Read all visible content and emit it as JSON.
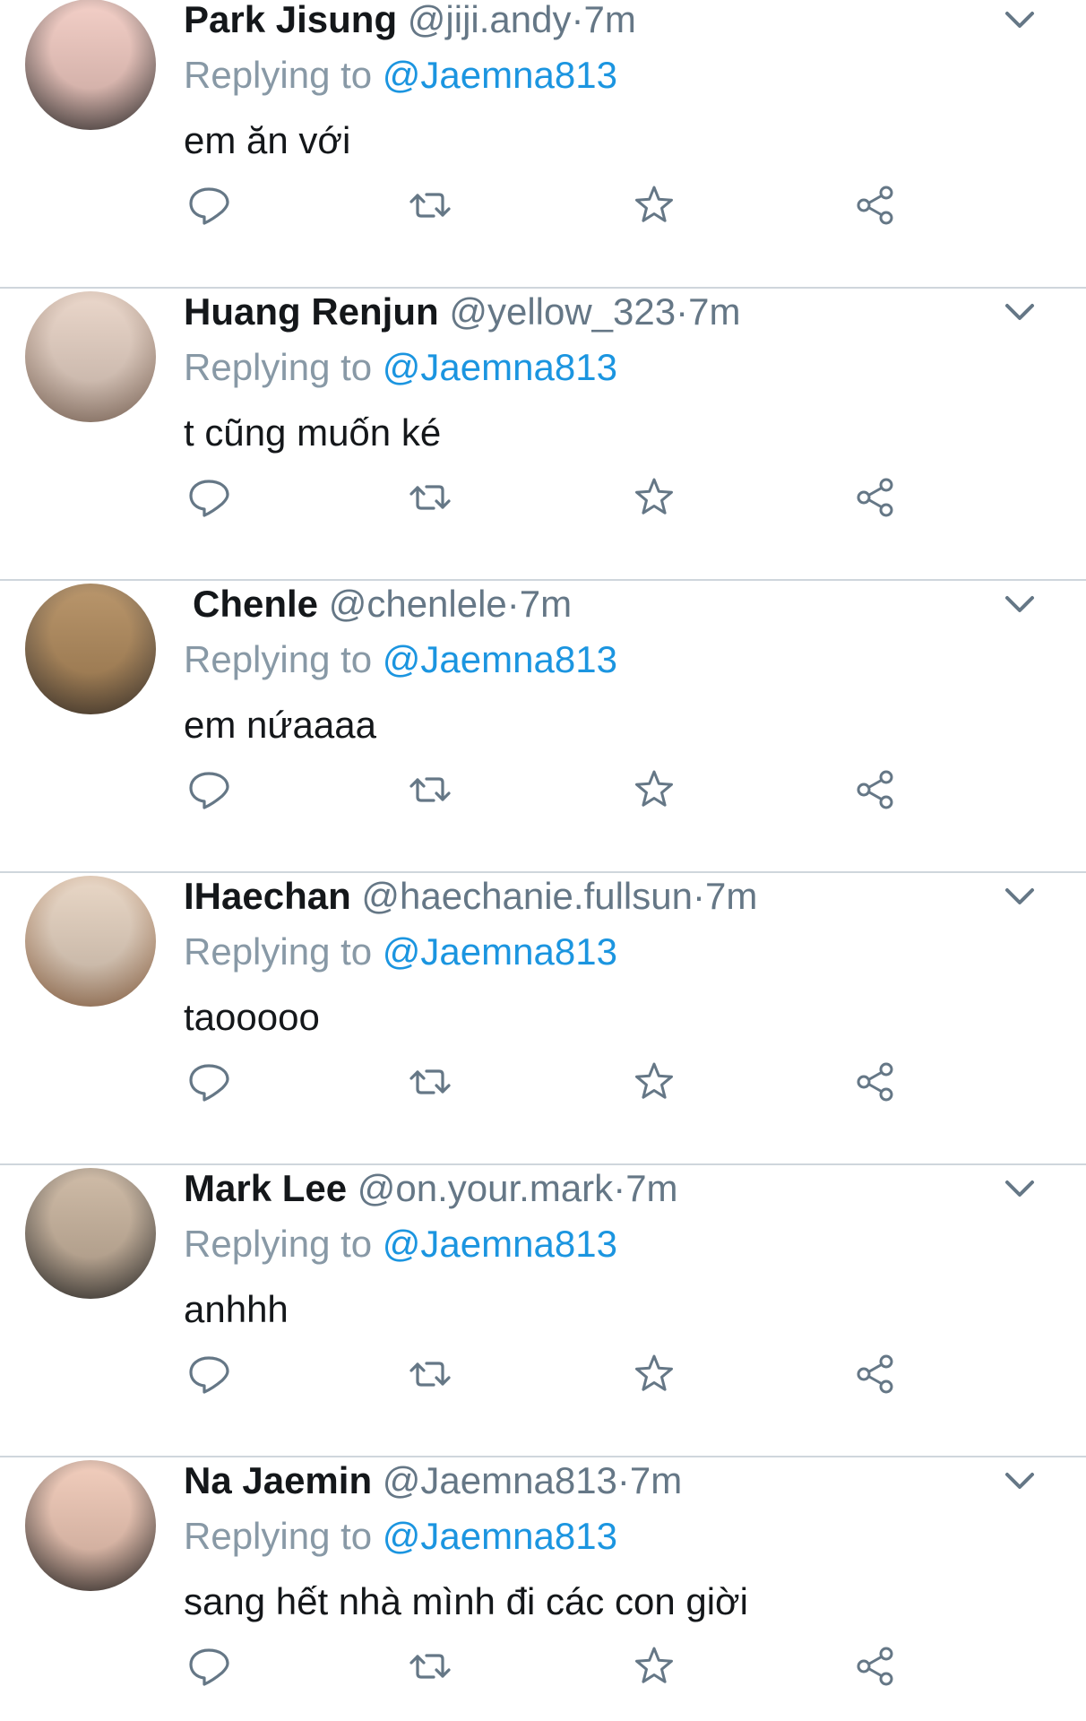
{
  "reply_prefix": "Replying to",
  "tweets": [
    {
      "name": "Park Jisung",
      "handle": "@jiji.andy",
      "dot": "·",
      "time": "7m",
      "reply_to": "@Jaemna813",
      "text": "em ăn với",
      "avatar_colors": [
        "#f2c9c0",
        "#2a2a2a"
      ]
    },
    {
      "name": "Huang Renjun",
      "handle": "@yellow_323",
      "dot": "·",
      "time": "7m",
      "reply_to": "@Jaemna813",
      "text": "t cũng muốn ké",
      "avatar_colors": [
        "#e8d2c4",
        "#8a6f5e"
      ]
    },
    {
      "name": "Chenle",
      "handle": "@chenlele",
      "dot": "·",
      "time": "7m",
      "reply_to": "@Jaemna813",
      "text": "em nứaaaa",
      "avatar_colors": [
        "#b08858",
        "#3c3530"
      ]
    },
    {
      "name": "IHaechan",
      "handle": "@haechanie.fullsun",
      "dot": "·",
      "time": "7m",
      "reply_to": "@Jaemna813",
      "text": "taooooo",
      "avatar_colors": [
        "#e6d2bf",
        "#9b6a45"
      ]
    },
    {
      "name": "Mark Lee",
      "handle": "@on.your.mark",
      "dot": "·",
      "time": "7m",
      "reply_to": "@Jaemna813",
      "text": "anhhh",
      "avatar_colors": [
        "#c9b39c",
        "#262626"
      ]
    },
    {
      "name": "Na Jaemin",
      "handle": "@Jaemna813",
      "dot": "·",
      "time": "7m",
      "reply_to": "@Jaemna813",
      "text": "sang hết nhà mình đi các con giời",
      "avatar_colors": [
        "#f0c7b4",
        "#1e1e1e"
      ]
    }
  ],
  "colors": {
    "name": "#14171a",
    "meta": "#657786",
    "reply_prefix": "#8899a6",
    "link": "#1b95e0",
    "icon": "#657786",
    "divider": "#cfd6dc"
  },
  "icons": [
    "chevron-down-icon",
    "reply-icon",
    "retweet-icon",
    "like-star-icon",
    "share-icon"
  ]
}
